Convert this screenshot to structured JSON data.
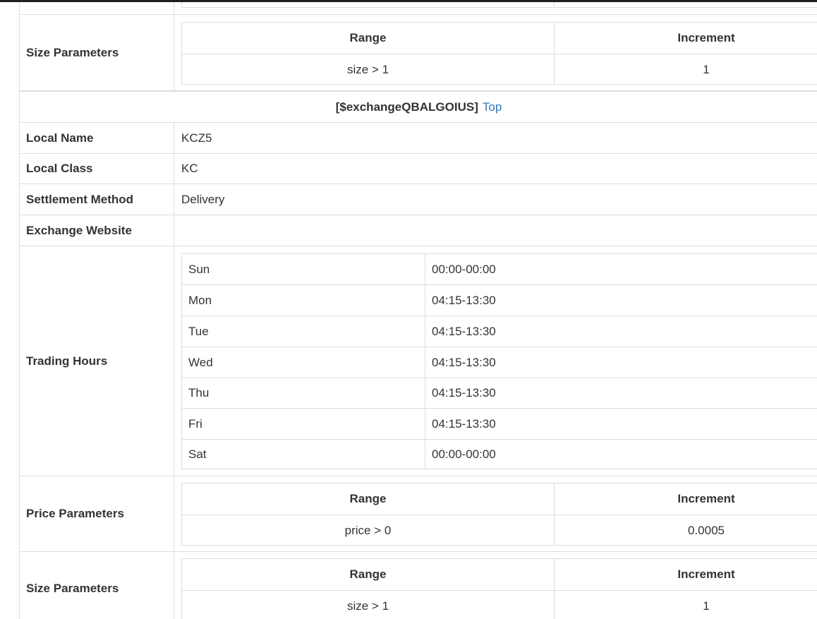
{
  "prev_size_params": {
    "label": "Size Parameters",
    "range_header": "Range",
    "increment_header": "Increment",
    "range": "size > 1",
    "increment": "1"
  },
  "section": {
    "title": "[$exchangeQBALGOIUS]",
    "top_link": "Top"
  },
  "local_name": {
    "label": "Local Name",
    "value": "KCZ5"
  },
  "local_class": {
    "label": "Local Class",
    "value": "KC"
  },
  "settlement": {
    "label": "Settlement Method",
    "value": "Delivery"
  },
  "website": {
    "label": "Exchange Website",
    "value": ""
  },
  "trading_hours": {
    "label": "Trading Hours",
    "days": [
      {
        "day": "Sun",
        "hours": "00:00-00:00"
      },
      {
        "day": "Mon",
        "hours": "04:15-13:30"
      },
      {
        "day": "Tue",
        "hours": "04:15-13:30"
      },
      {
        "day": "Wed",
        "hours": "04:15-13:30"
      },
      {
        "day": "Thu",
        "hours": "04:15-13:30"
      },
      {
        "day": "Fri",
        "hours": "04:15-13:30"
      },
      {
        "day": "Sat",
        "hours": "00:00-00:00"
      }
    ]
  },
  "price_params": {
    "label": "Price Parameters",
    "range_header": "Range",
    "increment_header": "Increment",
    "range": "price > 0",
    "increment": "0.0005"
  },
  "size_params": {
    "label": "Size Parameters",
    "range_header": "Range",
    "increment_header": "Increment",
    "range": "size > 1",
    "increment": "1"
  }
}
